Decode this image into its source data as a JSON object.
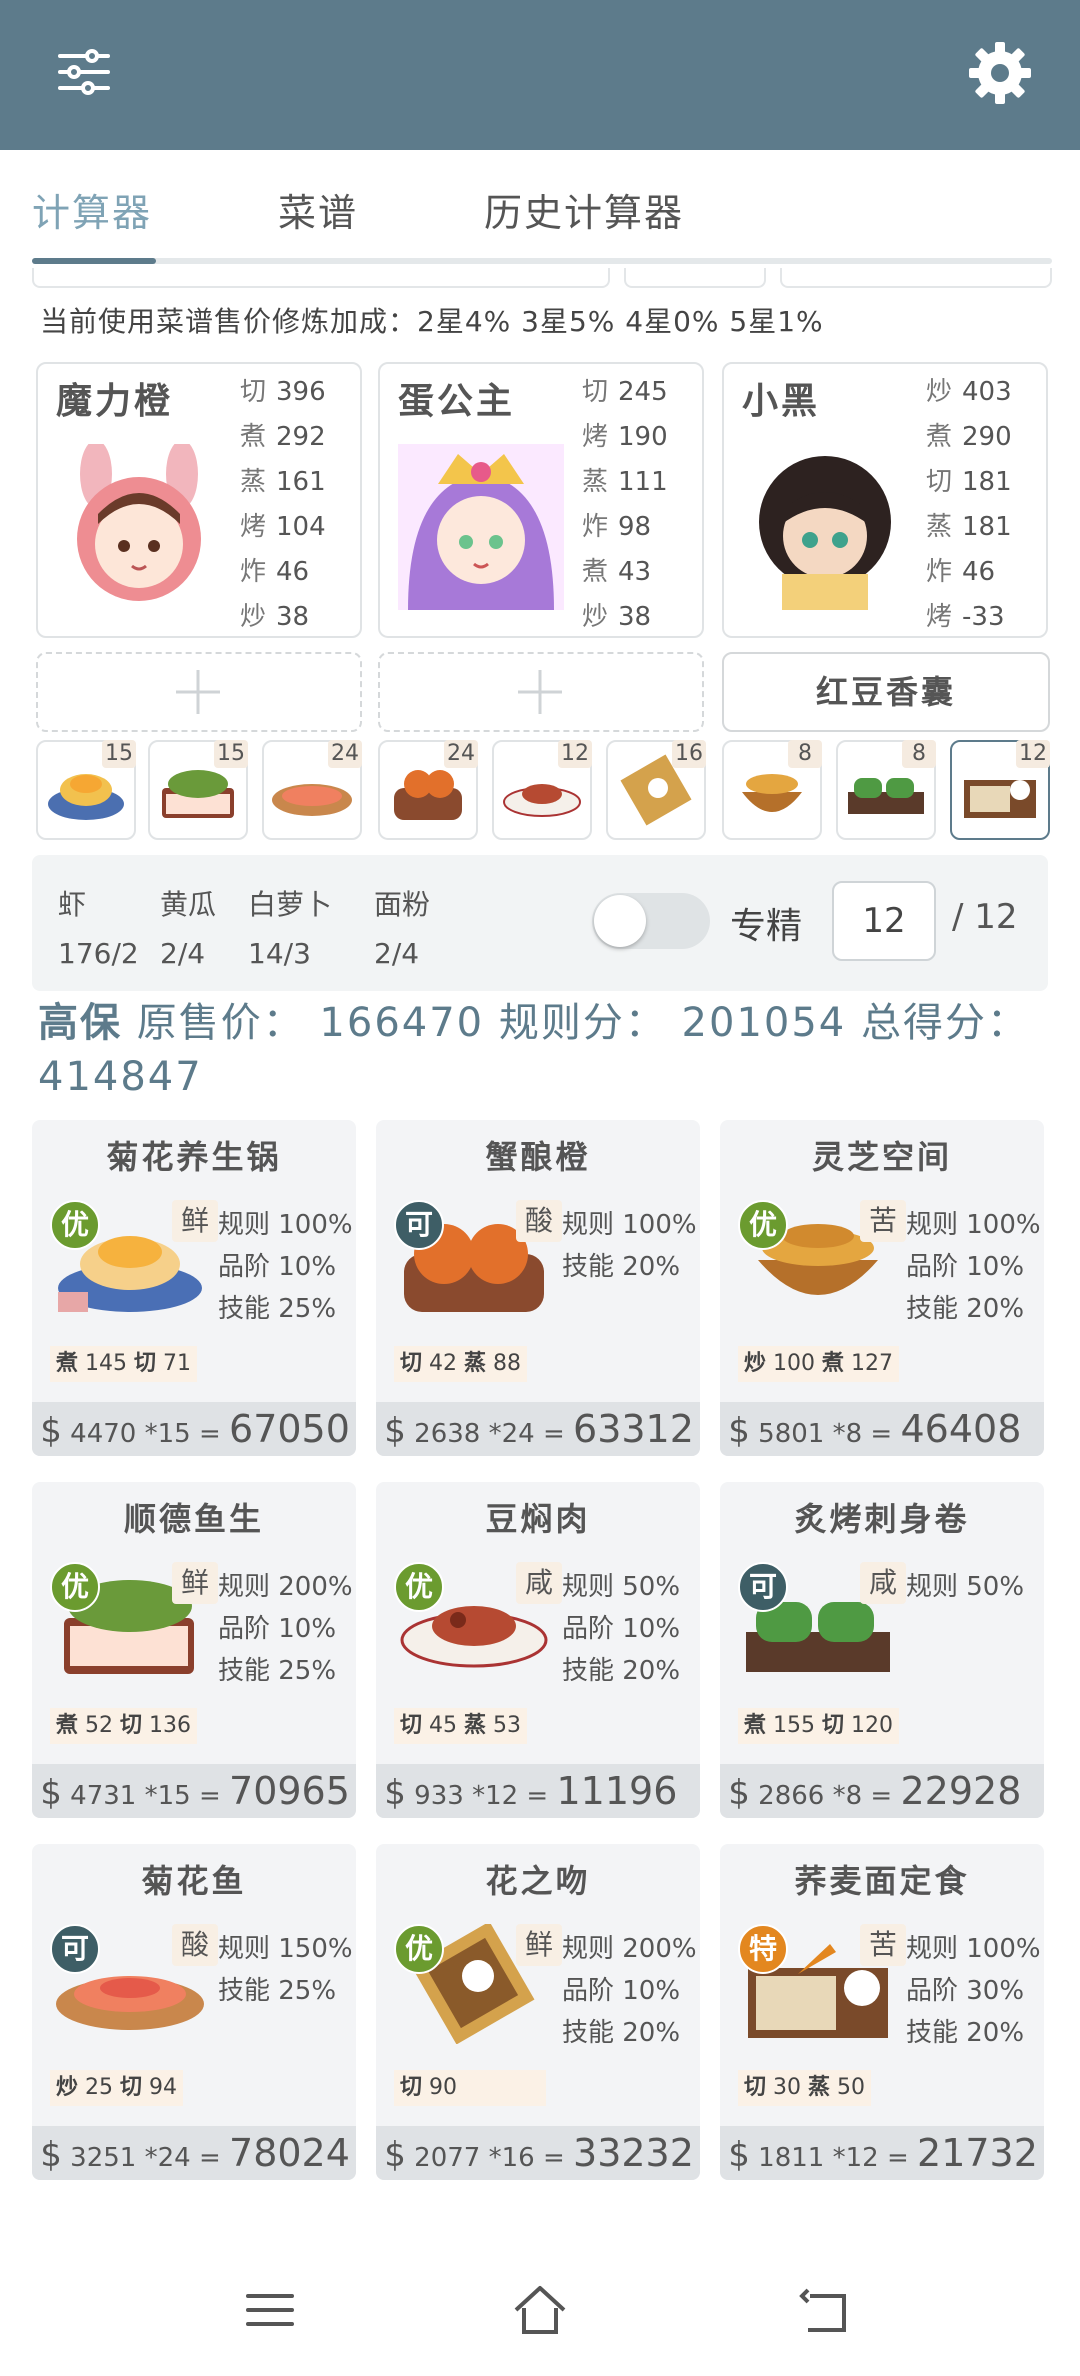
{
  "tabs": [
    {
      "label": "计算器"
    },
    {
      "label": "菜谱"
    },
    {
      "label": "历史计算器"
    }
  ],
  "bonus_text": "当前使用菜谱售价修炼加成：2星4% 3星5% 4星0% 5星1%",
  "chefs": [
    {
      "name": "魔力橙",
      "stats": [
        [
          "切",
          "396"
        ],
        [
          "煮",
          "292"
        ],
        [
          "蒸",
          "161"
        ],
        [
          "烤",
          "104"
        ],
        [
          "炸",
          "46"
        ],
        [
          "炒",
          "38"
        ]
      ]
    },
    {
      "name": "蛋公主",
      "stats": [
        [
          "切",
          "245"
        ],
        [
          "烤",
          "190"
        ],
        [
          "蒸",
          "111"
        ],
        [
          "炸",
          "98"
        ],
        [
          "煮",
          "43"
        ],
        [
          "炒",
          "38"
        ]
      ]
    },
    {
      "name": "小黑",
      "stats": [
        [
          "炒",
          "403"
        ],
        [
          "煮",
          "290"
        ],
        [
          "切",
          "181"
        ],
        [
          "蒸",
          "181"
        ],
        [
          "炸",
          "46"
        ],
        [
          "烤",
          "-33"
        ]
      ]
    }
  ],
  "equip_label": "红豆香囊",
  "dish_counts": [
    "15",
    "15",
    "24",
    "24",
    "12",
    "16",
    "8",
    "8",
    "12"
  ],
  "ingredients": [
    {
      "name": "虾",
      "value": "176/2"
    },
    {
      "name": "黄瓜",
      "value": "2/4"
    },
    {
      "name": "白萝卜",
      "value": "14/3"
    },
    {
      "name": "面粉",
      "value": "2/4"
    }
  ],
  "specialty_label": "专精",
  "specialty_value": "12",
  "specialty_total": "/ 12",
  "summary": {
    "level": "高保",
    "text": " 原售价： 166470 规则分： 201054 总得分：",
    "total": "414847"
  },
  "dishes": [
    {
      "title": "菊花养生锅",
      "badge": "优",
      "badge_color": "#6b9b2f",
      "flavor": "鲜",
      "rules": [
        "规则 100%",
        "品阶 10%",
        "技能 25%"
      ],
      "req": [
        [
          "煮",
          "145"
        ],
        [
          "切",
          "71"
        ]
      ],
      "price": "4470",
      "qty": "*15",
      "total": "67050"
    },
    {
      "title": "蟹酿橙",
      "badge": "可",
      "badge_color": "#3e5e66",
      "flavor": "酸",
      "rules": [
        "规则 100%",
        "技能 20%"
      ],
      "req": [
        [
          "切",
          "42"
        ],
        [
          "蒸",
          "88"
        ]
      ],
      "price": "2638",
      "qty": "*24",
      "total": "63312"
    },
    {
      "title": "灵芝空间",
      "badge": "优",
      "badge_color": "#6b9b2f",
      "flavor": "苦",
      "rules": [
        "规则 100%",
        "品阶 10%",
        "技能 20%"
      ],
      "req": [
        [
          "炒",
          "100"
        ],
        [
          "煮",
          "127"
        ]
      ],
      "price": "5801",
      "qty": "*8",
      "total": "46408"
    },
    {
      "title": "顺德鱼生",
      "badge": "优",
      "badge_color": "#6b9b2f",
      "flavor": "鲜",
      "rules": [
        "规则 200%",
        "品阶 10%",
        "技能 25%"
      ],
      "req": [
        [
          "煮",
          "52"
        ],
        [
          "切",
          "136"
        ]
      ],
      "price": "4731",
      "qty": "*15",
      "total": "70965"
    },
    {
      "title": "豆焖肉",
      "badge": "优",
      "badge_color": "#6b9b2f",
      "flavor": "咸",
      "rules": [
        "规则 50%",
        "品阶 10%",
        "技能 20%"
      ],
      "req": [
        [
          "切",
          "45"
        ],
        [
          "蒸",
          "53"
        ]
      ],
      "price": "933",
      "qty": "*12",
      "total": "11196"
    },
    {
      "title": "炙烤刺身卷",
      "badge": "可",
      "badge_color": "#3e5e66",
      "flavor": "咸",
      "rules": [
        "规则 50%"
      ],
      "req": [
        [
          "煮",
          "155"
        ],
        [
          "切",
          "120"
        ]
      ],
      "price": "2866",
      "qty": "*8",
      "total": "22928"
    },
    {
      "title": "菊花鱼",
      "badge": "可",
      "badge_color": "#3e5e66",
      "flavor": "酸",
      "rules": [
        "规则 150%",
        "技能 25%"
      ],
      "req": [
        [
          "炒",
          "25"
        ],
        [
          "切",
          "94"
        ]
      ],
      "price": "3251",
      "qty": "*24",
      "total": "78024"
    },
    {
      "title": "花之吻",
      "badge": "优",
      "badge_color": "#6b9b2f",
      "flavor": "鲜",
      "rules": [
        "规则 200%",
        "品阶 10%",
        "技能 20%"
      ],
      "req": [
        [
          "切",
          "90"
        ]
      ],
      "price": "2077",
      "qty": "*16",
      "total": "33232"
    },
    {
      "title": "荞麦面定食",
      "badge": "特",
      "badge_color": "#e3871f",
      "flavor": "苦",
      "rules": [
        "规则 100%",
        "品阶 30%",
        "技能 20%"
      ],
      "req": [
        [
          "切",
          "30"
        ],
        [
          "蒸",
          "50"
        ]
      ],
      "price": "1811",
      "qty": "*12",
      "total": "21732"
    }
  ],
  "icons": {
    "menu": "sliders-icon",
    "settings": "gear-icon",
    "nav": [
      "menu-icon",
      "home-icon",
      "back-icon"
    ]
  }
}
